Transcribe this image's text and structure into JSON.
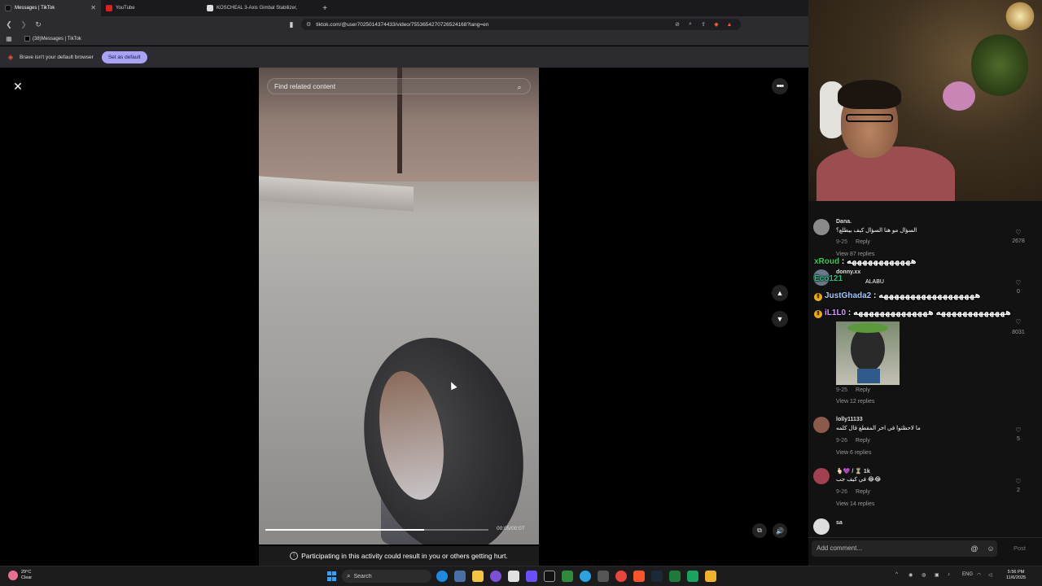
{
  "browser": {
    "tabs": [
      {
        "label": "Messages | TikTok",
        "active": true
      },
      {
        "label": "YouTube",
        "active": false
      },
      {
        "label": "KOSCHEAL 3-Axis Gimbal Stabilizer,",
        "active": false
      }
    ],
    "new_tab": "+",
    "url": "tiktok.com/@user7025014374433/video/7553654270726524168?lang=en",
    "bookmark": "(38)Messages | TikTok",
    "infobar_message": "Brave isn't your default browser",
    "set_default_label": "Set as default"
  },
  "video": {
    "search_placeholder": "Find related content",
    "timecode": "00:05/00:07",
    "progress_fraction": 0.71,
    "warning": "Participating in this activity could result in you or others getting hurt."
  },
  "comments": {
    "partial_top": "donny.xx",
    "items": [
      {
        "user": "Dana.",
        "text": "السؤال مو هنا السؤال كيف بيطلع؟",
        "date": "9-25",
        "reply": "Reply",
        "likes": "2678",
        "view_replies": "View 87 replies"
      },
      {
        "user": "donny.xx",
        "text": "ALABU",
        "date": "",
        "reply": "",
        "likes": "0",
        "view_replies": ""
      },
      {
        "user": "",
        "text": "",
        "date": "9-25",
        "reply": "Reply",
        "likes": "8031",
        "view_replies": "View 12 replies"
      },
      {
        "user": "lolly11133",
        "text": "ما لاحظتوا في اخر المقطع قال كلمه",
        "date": "9-26",
        "reply": "Reply",
        "likes": "5",
        "view_replies": "View 6 replies"
      },
      {
        "user": "🫰🏻💜 / ⏳ 1k",
        "text": "في كيف جب 😂😂",
        "date": "9-26",
        "reply": "Reply",
        "likes": "2",
        "view_replies": "View 14 replies"
      },
      {
        "user": "sa",
        "text": "",
        "date": "",
        "reply": "",
        "likes": "",
        "view_replies": ""
      }
    ],
    "add_placeholder": "Add comment...",
    "post_label": "Post"
  },
  "chat": [
    {
      "user": "xRoud",
      "color": "#2fd14f",
      "msg": "ههههههههههههه",
      "badge": ""
    },
    {
      "user": "Eco121",
      "color": "#1ec27a",
      "msg": "",
      "badge": ""
    },
    {
      "user": "JustGhada2",
      "color": "#9ecbff",
      "msg": "ههههههههههههههههههه",
      "badge": "!"
    },
    {
      "user": "iL1L0",
      "color": "#d796ff",
      "msg": "هههههههههههههه ههههههههههههههه",
      "badge": "!"
    }
  ],
  "taskbar": {
    "weather_temp": "29°C",
    "weather_desc": "Clear",
    "search_placeholder": "Search",
    "lang": "ENG",
    "time": "5:56 PM",
    "date": "11/6/2025"
  },
  "colors": {
    "accent_button": "#a8a3f5",
    "brave": "#fb542b",
    "panel": "#121212"
  },
  "icons": [
    "close-icon",
    "more-icon",
    "search-icon",
    "chevron-up-icon",
    "chevron-down-icon",
    "volume-icon",
    "miniplayer-icon",
    "heart-icon",
    "mention-icon",
    "emoji-icon"
  ]
}
